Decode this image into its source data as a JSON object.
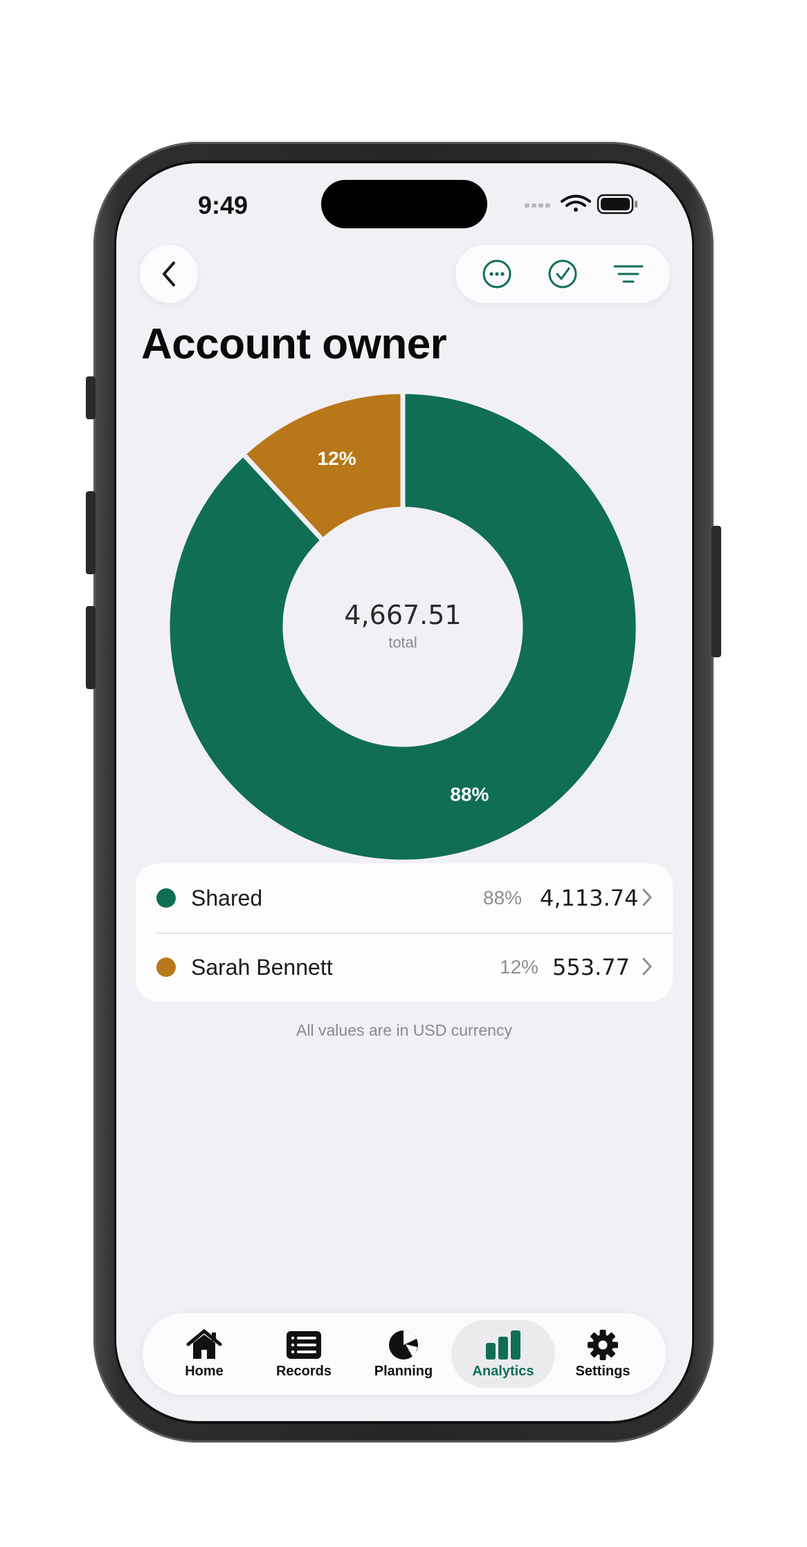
{
  "status_bar": {
    "time": "9:49"
  },
  "header": {
    "title": "Account owner"
  },
  "colors": {
    "accent": "#106e55",
    "secondary": "#b87718",
    "background": "#f1f0f5"
  },
  "icons": {
    "back": "chevron-left-icon",
    "more": "ellipsis-circle-icon",
    "check": "checkmark-circle-icon",
    "filter": "filter-lines-icon"
  },
  "chart_data": {
    "type": "pie",
    "center_value": "4,667.51",
    "center_label": "total",
    "series": [
      {
        "name": "Shared",
        "value": 4113.74,
        "percent_label": "88%",
        "color": "#106e55"
      },
      {
        "name": "Sarah Bennett",
        "value": 553.77,
        "percent_label": "12%",
        "color": "#b87718"
      }
    ]
  },
  "legend": {
    "rows": [
      {
        "name": "Shared",
        "percent": "88%",
        "amount": "4,113.74",
        "color": "#106e55"
      },
      {
        "name": "Sarah Bennett",
        "percent": "12%",
        "amount": "553.77",
        "color": "#b87718"
      }
    ]
  },
  "footer_note": "All values are in USD currency",
  "tabbar": {
    "tabs": [
      {
        "label": "Home",
        "icon": "house-icon"
      },
      {
        "label": "Records",
        "icon": "list-icon"
      },
      {
        "label": "Planning",
        "icon": "pie-chart-icon"
      },
      {
        "label": "Analytics",
        "icon": "bar-chart-icon",
        "active": true
      },
      {
        "label": "Settings",
        "icon": "gear-icon"
      }
    ]
  }
}
